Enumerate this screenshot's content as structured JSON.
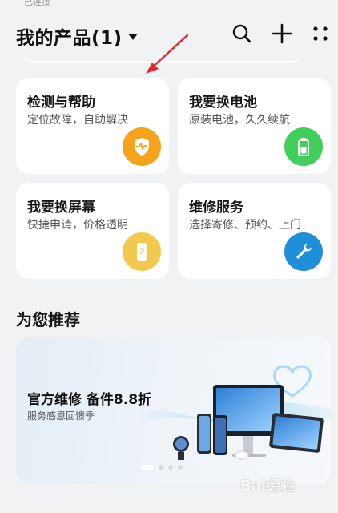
{
  "status": {
    "fragment": "已连接"
  },
  "header": {
    "title": "我的产品(1)",
    "icons": [
      "search-icon",
      "add-icon",
      "more-grid-icon"
    ]
  },
  "services": [
    {
      "title": "检测与帮助",
      "subtitle": "定位故障，自助解决",
      "icon": "shield-heartbeat-icon",
      "color": "#f5a31a"
    },
    {
      "title": "我要换电池",
      "subtitle": "原装电池，久久续航",
      "icon": "battery-icon",
      "color": "#3fcf5a"
    },
    {
      "title": "我要换屏幕",
      "subtitle": "快捷申请，价格透明",
      "icon": "phone-screen-icon",
      "color": "#f2c94c"
    },
    {
      "title": "维修服务",
      "subtitle": "选择寄修、预约、上门",
      "icon": "wrench-icon",
      "color": "#1e8fd8"
    }
  ],
  "recommend": {
    "section_title": "为您推荐",
    "banner_title": "官方维修 备件8.8折",
    "banner_subtitle": "服务感恩回馈季",
    "carousel_pages": 4,
    "carousel_active": 1
  },
  "watermark": {
    "text": "Bai经验"
  },
  "colors": {
    "accent_arrow": "#e6262b",
    "background": "#f1f2f4"
  }
}
